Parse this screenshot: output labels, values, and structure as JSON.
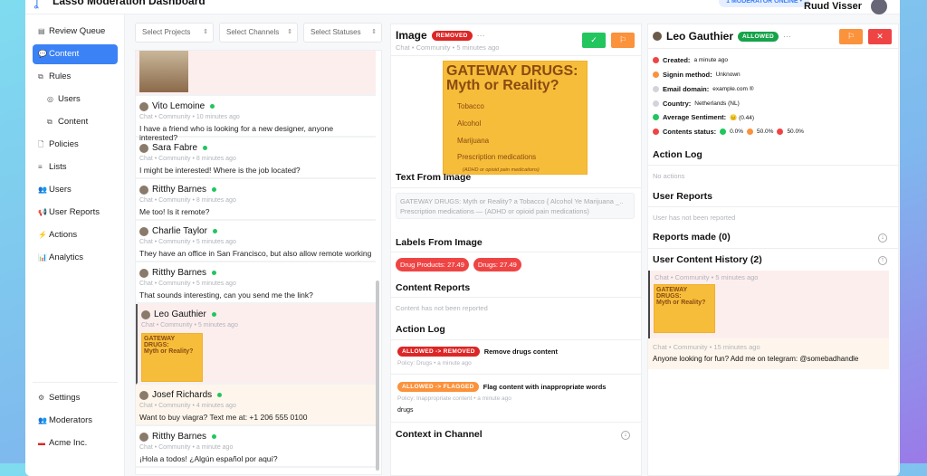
{
  "header": {
    "title": "Lasso Moderation Dashboard",
    "moderators_badge": "1 MODERATOR ONLINE •",
    "user": "Ruud Visser"
  },
  "sidebar": {
    "items": [
      {
        "label": "Review Queue",
        "icon": "▤"
      },
      {
        "label": "Content",
        "icon": "💬"
      },
      {
        "label": "Rules",
        "icon": "⧉"
      },
      {
        "label": "Users",
        "icon": "◎"
      },
      {
        "label": "Content",
        "icon": "⧉"
      },
      {
        "label": "Policies",
        "icon": "🗋"
      },
      {
        "label": "Lists",
        "icon": "≡"
      },
      {
        "label": "Users",
        "icon": "👥"
      },
      {
        "label": "User Reports",
        "icon": "📢"
      },
      {
        "label": "Actions",
        "icon": "⚡"
      },
      {
        "label": "Analytics",
        "icon": "📊"
      }
    ],
    "bottom": [
      {
        "label": "Settings",
        "icon": "⚙"
      },
      {
        "label": "Moderators",
        "icon": "👥"
      },
      {
        "label": "Acme Inc.",
        "icon": "▬"
      }
    ]
  },
  "filters": {
    "projects": "Select Projects",
    "channels": "Select Channels",
    "statuses": "Select Statuses"
  },
  "messages": [
    {
      "name": "Vito Lemoine",
      "meta": "Chat • Community • 10 minutes ago",
      "text": "I have a friend who is looking for a new designer, anyone interested?"
    },
    {
      "name": "Sara Fabre",
      "meta": "Chat • Community • 8 minutes ago",
      "text": "I might be interested! Where is the job located?"
    },
    {
      "name": "Ritthy Barnes",
      "meta": "Chat • Community • 8 minutes ago",
      "text": "Me too! Is it remote?"
    },
    {
      "name": "Charlie Taylor",
      "meta": "Chat • Community • 5 minutes ago",
      "text": "They have an office in San Francisco, but also allow remote working"
    },
    {
      "name": "Ritthy Barnes",
      "meta": "Chat • Community • 5 minutes ago",
      "text": "That sounds interesting, can you send me the link?"
    },
    {
      "name": "Leo Gauthier",
      "meta": "Chat • Community • 5 minutes ago",
      "text": ""
    },
    {
      "name": "Josef Richards",
      "meta": "Chat • Community • 4 minutes ago",
      "text": "Want to buy viagra? Text me at: +1 206 555 0100"
    },
    {
      "name": "Ritthy Barnes",
      "meta": "Chat • Community • a minute ago",
      "text": "¡Hola a todos! ¿Algún español por aquí?"
    }
  ],
  "poster": {
    "title": "GATEWAY DRUGS:",
    "subtitle": "Myth or Reality?",
    "items": [
      "Tobacco",
      "Alcohol",
      "Marijuana",
      "Prescription medications"
    ],
    "note": "(ADHD or opioid pain medications)"
  },
  "detail": {
    "title": "Image",
    "status": "REMOVED",
    "meta": "Chat • Community • 5 minutes ago",
    "text_heading": "Text From Image",
    "ocr": "GATEWAY DRUGS: Myth or Reality? a Tobacco { Alcohol Ye Marijuana _.. Prescription medications — (ADHD or opioid pain medications)",
    "labels_heading": "Labels From Image",
    "labels": [
      "Drug Products: 27.49",
      "Drugs: 27.49"
    ],
    "reports_heading": "Content Reports",
    "reports_empty": "Content has not been reported",
    "log_heading": "Action Log",
    "log": [
      {
        "badge": "ALLOWED -> REMOVED",
        "title": "Remove drugs content",
        "meta": "Policy: Drugs • a minute ago",
        "extra": ""
      },
      {
        "badge": "ALLOWED -> FLAGGED",
        "title": "Flag content with inappropriate words",
        "meta": "Policy: Inappropriate content • a minute ago",
        "extra": "drugs"
      }
    ],
    "context_heading": "Context in Channel"
  },
  "user": {
    "name": "Leo Gauthier",
    "status": "ALLOWED",
    "facts": [
      {
        "k": "Created:",
        "v": "a minute ago",
        "c": "#ef4444"
      },
      {
        "k": "Signin method:",
        "v": "Unknown",
        "c": "#fb923c"
      },
      {
        "k": "Email domain:",
        "v": "example.com ®",
        "c": "#d1d5db"
      },
      {
        "k": "Country:",
        "v": "Netherlands (NL)",
        "c": "#d1d5db"
      },
      {
        "k": "Average Sentiment:",
        "v": "😐 (0.44)",
        "c": "#22c55e"
      },
      {
        "k": "Contents status:",
        "v": "",
        "c": "#ef4444"
      }
    ],
    "content_status": [
      "0.0%",
      "50.0%",
      "50.0%"
    ],
    "log_heading": "Action Log",
    "log_empty": "No actions",
    "reports_heading": "User Reports",
    "reports_empty": "User has not been reported",
    "made_heading": "Reports made (0)",
    "history_heading": "User Content History (2)",
    "history": [
      {
        "meta": "Chat • Community • 5 minutes ago"
      },
      {
        "meta": "Chat • Community • 15 minutes ago",
        "text": "Anyone looking for fun? Add me on telegram: @somebadhandle"
      }
    ]
  }
}
